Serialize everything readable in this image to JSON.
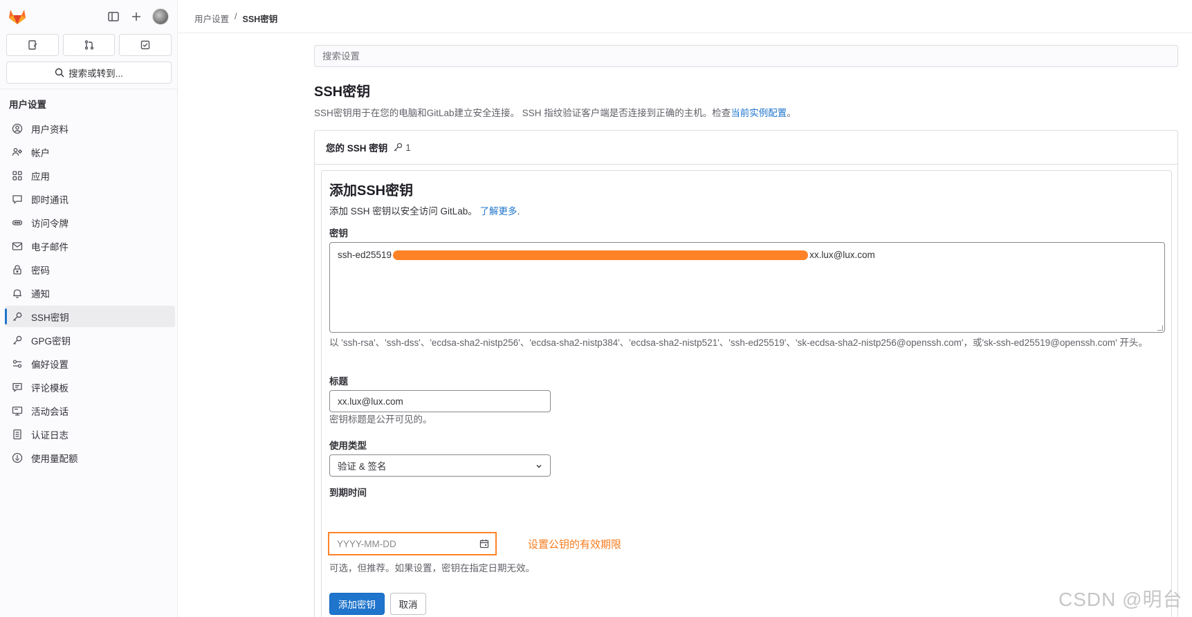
{
  "sidebar": {
    "search_label": "搜索或转到...",
    "section_title": "用户设置",
    "items": [
      {
        "label": "用户资料",
        "icon": "profile-icon"
      },
      {
        "label": "帐户",
        "icon": "account-icon"
      },
      {
        "label": "应用",
        "icon": "applications-icon"
      },
      {
        "label": "即时通讯",
        "icon": "chat-icon"
      },
      {
        "label": "访问令牌",
        "icon": "token-icon"
      },
      {
        "label": "电子邮件",
        "icon": "mail-icon"
      },
      {
        "label": "密码",
        "icon": "lock-icon"
      },
      {
        "label": "通知",
        "icon": "bell-icon"
      },
      {
        "label": "SSH密钥",
        "icon": "key-icon",
        "active": true
      },
      {
        "label": "GPG密钥",
        "icon": "key-icon"
      },
      {
        "label": "偏好设置",
        "icon": "preferences-icon"
      },
      {
        "label": "评论模板",
        "icon": "comment-template-icon"
      },
      {
        "label": "活动会话",
        "icon": "session-icon"
      },
      {
        "label": "认证日志",
        "icon": "log-icon"
      },
      {
        "label": "使用量配额",
        "icon": "quota-icon"
      }
    ]
  },
  "breadcrumb": {
    "parent": "用户设置",
    "separator": "/",
    "current": "SSH密钥"
  },
  "settings_search": {
    "placeholder": "搜索设置"
  },
  "page": {
    "title": "SSH密钥",
    "description": "SSH密钥用于在您的电脑和GitLab建立安全连接。 SSH 指纹验证客户端是否连接到正确的主机。检查",
    "description_link": "当前实例配置",
    "description_end": "。"
  },
  "card": {
    "header_label": "您的 SSH 密钥",
    "key_count": "1"
  },
  "form": {
    "title": "添加SSH密钥",
    "description": "添加 SSH 密钥以安全访问 GitLab。",
    "learn_more": "了解更多",
    "learn_more_end": ".",
    "key_label": "密钥",
    "key_prefix": "ssh-ed25519",
    "key_suffix": "xx.lux@lux.com",
    "key_help": "以 'ssh-rsa'、'ssh-dss'、'ecdsa-sha2-nistp256'、'ecdsa-sha2-nistp384'、'ecdsa-sha2-nistp521'、'ssh-ed25519'、'sk-ecdsa-sha2-nistp256@openssh.com'，或'sk-ssh-ed25519@openssh.com' 开头。",
    "title_label": "标题",
    "title_value": "xx.lux@lux.com",
    "title_help": "密钥标题是公开可见的。",
    "usage_label": "使用类型",
    "usage_value": "验证 & 签名",
    "expiry_label": "到期时间",
    "expiry_placeholder": "YYYY-MM-DD",
    "expiry_help": "可选，但推荐。如果设置，密钥在指定日期无效。",
    "annotation": "设置公钥的有效期限",
    "submit_label": "添加密钥",
    "cancel_label": "取消"
  },
  "watermark": "CSDN @明台",
  "colors": {
    "primary": "#1f75cb",
    "highlight": "#ff8326"
  }
}
